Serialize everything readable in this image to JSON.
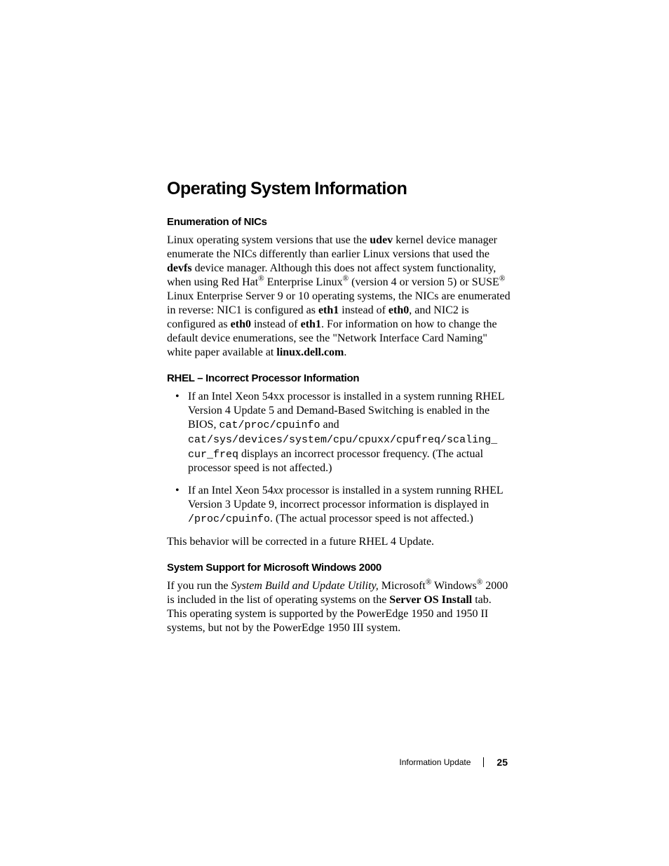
{
  "title": "Operating System Information",
  "sections": [
    {
      "heading": "Enumeration of NICs",
      "body_html": "Linux operating system versions that use the <b>udev</b> kernel device manager enumerate the NICs differently than earlier Linux versions that used the <b>devfs</b> device manager. Although this does not affect system functionality, when using Red Hat<span class='reg'>®</span> Enterprise Linux<span class='reg'>®</span> (version 4 or version 5) or SUSE<span class='reg'>®</span> Linux Enterprise Server 9 or 10 operating systems, the NICs are enumerated in reverse: NIC1 is configured as <b>eth1</b> instead of <b>eth0</b>, and NIC2 is configured as <b>eth0</b> instead of <b>eth1</b>. For information on how to change the default device enumerations, see the \"Network Interface Card Naming\" white paper available at <b>linux.dell.com</b>."
    },
    {
      "heading": "RHEL – Incorrect Processor Information",
      "bullets": [
        "If an Intel Xeon 54xx processor is installed in a system running RHEL Version 4 Update 5 and Demand-Based Switching is enabled in the BIOS, <span class='mono'>cat/proc/cpuinfo</span> and <span class='mono'>cat/sys/devices/system/cpu/cpuxx/cpufreq/scaling_ cur_freq</span> displays an incorrect processor frequency. (The actual processor speed is not affected.)",
        "If an Intel Xeon 54<i>xx</i> processor is installed in a system running RHEL Version 3 Update 9, incorrect processor information is displayed in <span class='mono'>/proc/cpuinfo</span>. (The actual processor speed is not affected.)"
      ],
      "after": "This behavior will be corrected in a future RHEL 4 Update."
    },
    {
      "heading": "System Support for Microsoft Windows 2000",
      "body_html": "If you run the <i>System Build and Update Utility,</i> Microsoft<span class='reg'>®</span> Windows<span class='reg'>®</span> 2000 is included in the list of operating systems on the <b>Server OS Install</b> tab. This operating system is supported by the PowerEdge 1950 and 1950 II systems, but not by the PowerEdge 1950 III system."
    }
  ],
  "footer": {
    "label": "Information Update",
    "page": "25"
  }
}
